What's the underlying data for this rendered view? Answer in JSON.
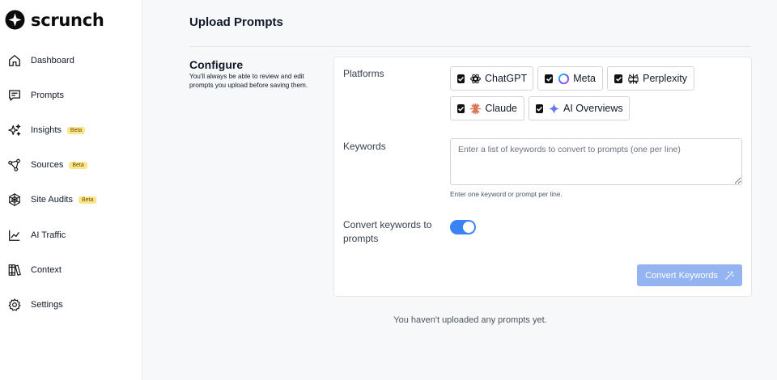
{
  "brand": {
    "name": "scrunch"
  },
  "sidebar": {
    "items": [
      {
        "label": "Dashboard",
        "icon": "home-icon",
        "badge": ""
      },
      {
        "label": "Prompts",
        "icon": "chat-icon",
        "badge": ""
      },
      {
        "label": "Insights",
        "icon": "sparkles-icon",
        "badge": "Beta"
      },
      {
        "label": "Sources",
        "icon": "share-nodes-icon",
        "badge": "Beta"
      },
      {
        "label": "Site Audits",
        "icon": "globe-icon",
        "badge": "Beta"
      },
      {
        "label": "AI Traffic",
        "icon": "chart-line-icon",
        "badge": ""
      },
      {
        "label": "Context",
        "icon": "books-icon",
        "badge": ""
      },
      {
        "label": "Settings",
        "icon": "gear-icon",
        "badge": ""
      }
    ]
  },
  "page": {
    "title": "Upload Prompts"
  },
  "configure": {
    "title": "Configure",
    "description": "You'll always be able to review and edit prompts you upload before saving them."
  },
  "platforms": {
    "label": "Platforms",
    "options": [
      {
        "label": "ChatGPT",
        "checked": true,
        "icon": "openai-icon"
      },
      {
        "label": "Meta",
        "checked": true,
        "icon": "meta-ring-icon"
      },
      {
        "label": "Perplexity",
        "checked": true,
        "icon": "perplexity-icon"
      },
      {
        "label": "Claude",
        "checked": true,
        "icon": "claude-icon"
      },
      {
        "label": "AI Overviews",
        "checked": true,
        "icon": "gemini-sparkle-icon"
      }
    ]
  },
  "keywords": {
    "label": "Keywords",
    "value": "",
    "placeholder": "Enter a list of keywords to convert to prompts (one per line)",
    "hint": "Enter one keyword or prompt per line."
  },
  "convert_toggle": {
    "label": "Convert keywords to prompts",
    "enabled": true
  },
  "convert_button": {
    "label": "Convert Keywords",
    "icon": "magic-wand-icon"
  },
  "empty_state": {
    "message": "You haven't uploaded any prompts yet."
  },
  "colors": {
    "accent": "#3b82f6",
    "button_disabled": "#93b4f1",
    "beta_badge": "#fde68a"
  }
}
